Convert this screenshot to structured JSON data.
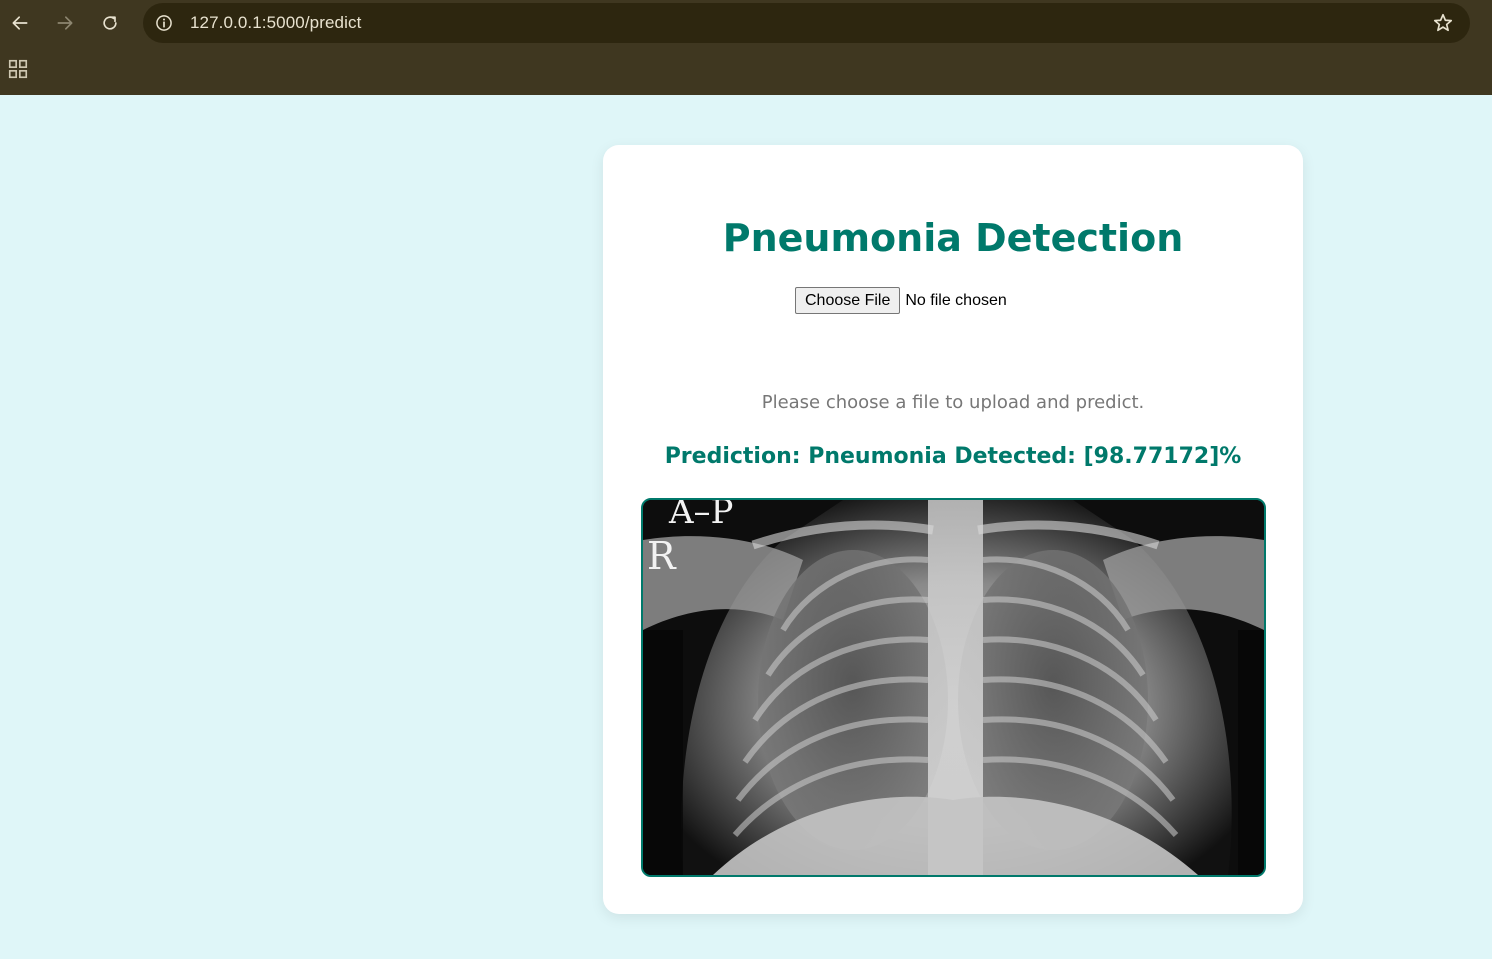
{
  "browser": {
    "url": "127.0.0.1:5000/predict",
    "icons": {
      "back": "arrow-left-icon",
      "forward": "arrow-right-icon",
      "reload": "reload-icon",
      "site_info": "info-icon",
      "bookmark": "star-icon",
      "apps": "apps-grid-icon"
    }
  },
  "page": {
    "title": "Pneumonia Detection",
    "file_input": {
      "button_label": "Choose File",
      "status": "No file chosen"
    },
    "hint": "Please choose a file to upload and predict.",
    "prediction": "Prediction: Pneumonia Detected: [98.77172]%",
    "xray_image": {
      "label_top": "A–P",
      "label_side": "R"
    }
  },
  "colors": {
    "accent": "#00796b",
    "page_bg": "#dff6f8",
    "chrome_bg": "#3f3720",
    "omnibox_bg": "#2d260f",
    "hint_text": "#777777"
  }
}
